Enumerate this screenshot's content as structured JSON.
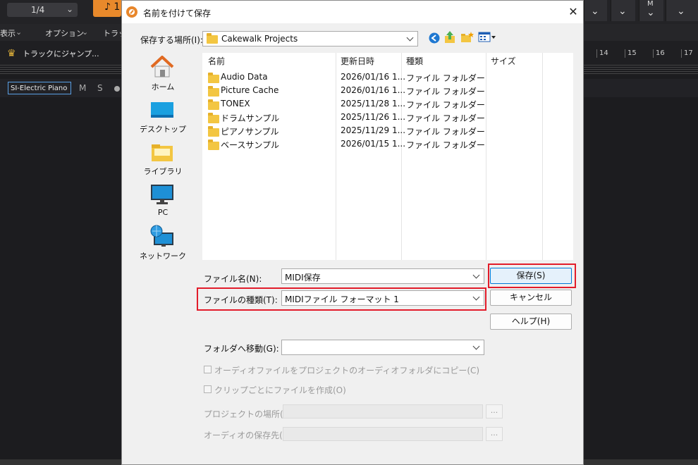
{
  "daw": {
    "position": "1/4",
    "orange_btn": "♪ 1",
    "menu": [
      "表示",
      "オプション",
      "トラッ"
    ],
    "jump_label": "トラックにジャンプ...",
    "ruler": [
      "14",
      "15",
      "16",
      "17"
    ],
    "track_name": "SI-Electric Piano",
    "mute": "M",
    "solo": "S",
    "right_box_3_label": "M"
  },
  "dialog": {
    "title": "名前を付けて保存",
    "save_in_label": "保存する場所(I):",
    "save_in_value": "Cakewalk Projects",
    "places": [
      {
        "label": "ホーム",
        "icon": "home-icon"
      },
      {
        "label": "デスクトップ",
        "icon": "desktop-icon"
      },
      {
        "label": "ライブラリ",
        "icon": "library-icon"
      },
      {
        "label": "PC",
        "icon": "pc-icon"
      },
      {
        "label": "ネットワーク",
        "icon": "network-icon"
      }
    ],
    "columns": [
      "名前",
      "更新日時",
      "種類",
      "サイズ"
    ],
    "files": [
      {
        "name": "Audio Data",
        "date": "2026/01/16 1...",
        "type": "ファイル フォルダー"
      },
      {
        "name": "Picture Cache",
        "date": "2026/01/16 1...",
        "type": "ファイル フォルダー"
      },
      {
        "name": "TONEX",
        "date": "2025/11/28 1...",
        "type": "ファイル フォルダー"
      },
      {
        "name": "ドラムサンプル",
        "date": "2025/11/26 1...",
        "type": "ファイル フォルダー"
      },
      {
        "name": "ピアノサンプル",
        "date": "2025/11/29 1...",
        "type": "ファイル フォルダー"
      },
      {
        "name": "ベースサンプル",
        "date": "2026/01/15 1...",
        "type": "ファイル フォルダー"
      }
    ],
    "filename_label": "ファイル名(N):",
    "filename_value": "MIDI保存",
    "filetype_label": "ファイルの種類(T):",
    "filetype_value": "MIDIファイル フォーマット 1",
    "save_button": "保存(S)",
    "cancel_button": "キャンセル",
    "help_button": "ヘルプ(H)",
    "goto_folder_label": "フォルダへ移動(G):",
    "goto_folder_value": "",
    "copy_audio_label": "オーディオファイルをプロジェクトのオーディオフォルダにコピー(C)",
    "per_clip_label": "クリップごとにファイルを作成(O)",
    "project_location_label": "プロジェクトの場所(E):",
    "audio_dest_label": "オーディオの保存先(A):",
    "browse_label": "...",
    "accent_color": "#0078d7",
    "highlight_color": "#e21c2a"
  }
}
